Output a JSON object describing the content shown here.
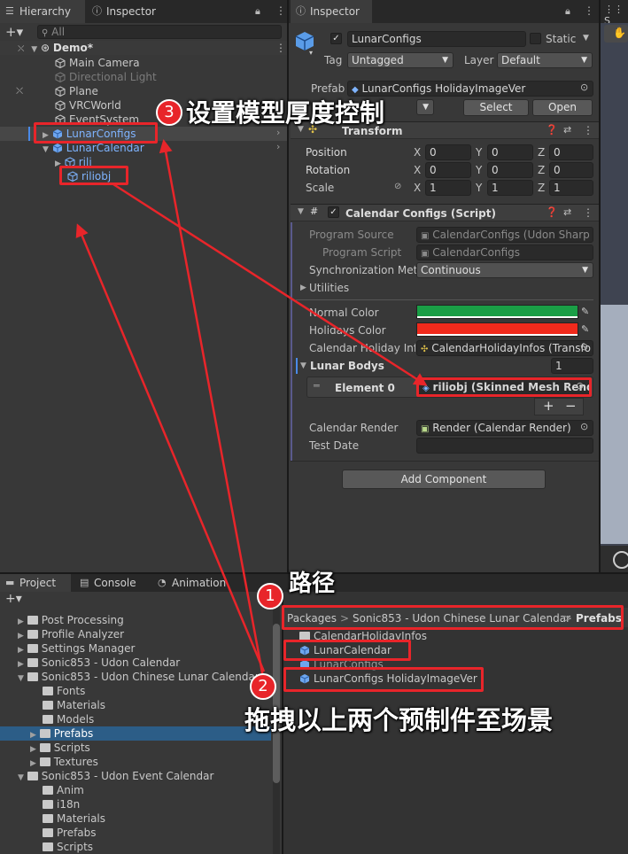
{
  "hierarchy": {
    "tab_label": "Hierarchy",
    "search_placeholder": "All",
    "scene_name": "Demo*",
    "items": [
      {
        "label": "Main Camera"
      },
      {
        "label": "Directional Light"
      },
      {
        "label": "VRCWorld"
      },
      {
        "label": "Plane"
      },
      {
        "label": "EventSystem"
      },
      {
        "label": "LunarConfigs"
      },
      {
        "label": "LunarCalendar"
      },
      {
        "label": "rili"
      },
      {
        "label": "riliobj"
      }
    ]
  },
  "left_inspector_tab": "Inspector",
  "inspector": {
    "tab_label": "Inspector",
    "object_name": "LunarConfigs",
    "static_label": "Static",
    "tag_label": "Tag",
    "tag_value": "Untagged",
    "layer_label": "Layer",
    "layer_value": "Default",
    "prefab_label": "Prefab",
    "prefab_value": "LunarConfigs HolidayImageVer",
    "select_button": "Select",
    "open_button": "Open",
    "transform": {
      "title": "Transform",
      "rows": [
        {
          "label": "Position",
          "x": "0",
          "y": "0",
          "z": "0"
        },
        {
          "label": "Rotation",
          "x": "0",
          "y": "0",
          "z": "0"
        },
        {
          "label": "Scale",
          "x": "1",
          "y": "1",
          "z": "1"
        }
      ],
      "axis_x": "X",
      "axis_y": "Y",
      "axis_z": "Z"
    },
    "script": {
      "title": "Calendar Configs (Script)",
      "program_source_label": "Program Source",
      "program_source_value": "CalendarConfigs (Udon Sharp",
      "program_script_label": "Program Script",
      "program_script_value": "CalendarConfigs",
      "sync_label": "Synchronization Metl",
      "sync_value": "Continuous",
      "utilities_label": "Utilities",
      "normal_color_label": "Normal Color",
      "holidays_color_label": "Holidays Color",
      "holiday_info_label": "Calendar Holiday Info",
      "holiday_info_value": "CalendarHolidayInfos (Transfo",
      "lunar_bodys_label": "Lunar Bodys",
      "lunar_bodys_count": "1",
      "element0_label": "Element 0",
      "element0_value": "riliobj (Skinned Mesh Rende",
      "plus": "+",
      "minus": "−",
      "render_label": "Calendar Render",
      "render_value": "Render (Calendar Render)",
      "test_date_label": "Test Date",
      "test_date_value": ""
    },
    "add_component": "Add Component"
  },
  "colors": {
    "normal": "#1a9e46",
    "holiday": "#f02a1c",
    "annotation_red": "#e8252a"
  },
  "scene_tab": "S",
  "bottom_tabs": {
    "project": "Project",
    "console": "Console",
    "animation": "Animation"
  },
  "project_tree": [
    {
      "label": "Post Processing",
      "depth": 0
    },
    {
      "label": "Profile Analyzer",
      "depth": 0
    },
    {
      "label": "Settings Manager",
      "depth": 0
    },
    {
      "label": "Sonic853 - Udon Calendar",
      "depth": 0
    },
    {
      "label": "Sonic853 - Udon Chinese Lunar Calendar",
      "depth": 0
    },
    {
      "label": "Fonts",
      "depth": 1
    },
    {
      "label": "Materials",
      "depth": 1
    },
    {
      "label": "Models",
      "depth": 1
    },
    {
      "label": "Prefabs",
      "depth": 1
    },
    {
      "label": "Scripts",
      "depth": 1
    },
    {
      "label": "Textures",
      "depth": 1
    },
    {
      "label": "Sonic853 - Udon Event Calendar",
      "depth": 0
    },
    {
      "label": "Anim",
      "depth": 1
    },
    {
      "label": "i18n",
      "depth": 1
    },
    {
      "label": "Materials",
      "depth": 1
    },
    {
      "label": "Prefabs",
      "depth": 1
    },
    {
      "label": "Scripts",
      "depth": 1
    }
  ],
  "breadcrumb": {
    "parts": [
      "Packages",
      "Sonic853 - Udon Chinese Lunar Calendar",
      "Prefabs"
    ],
    "sep": ">"
  },
  "project_files": [
    {
      "label": "CalendarHolidayInfos"
    },
    {
      "label": "LunarCalendar"
    },
    {
      "label": "LunarConfigs"
    },
    {
      "label": "LunarConfigs HolidayImageVer"
    }
  ],
  "annotations": {
    "badge1": "1",
    "badge2": "2",
    "badge3": "3",
    "text1": "路径",
    "text2": "拖拽以上两个预制件至场景",
    "text3": "设置模型厚度控制"
  }
}
